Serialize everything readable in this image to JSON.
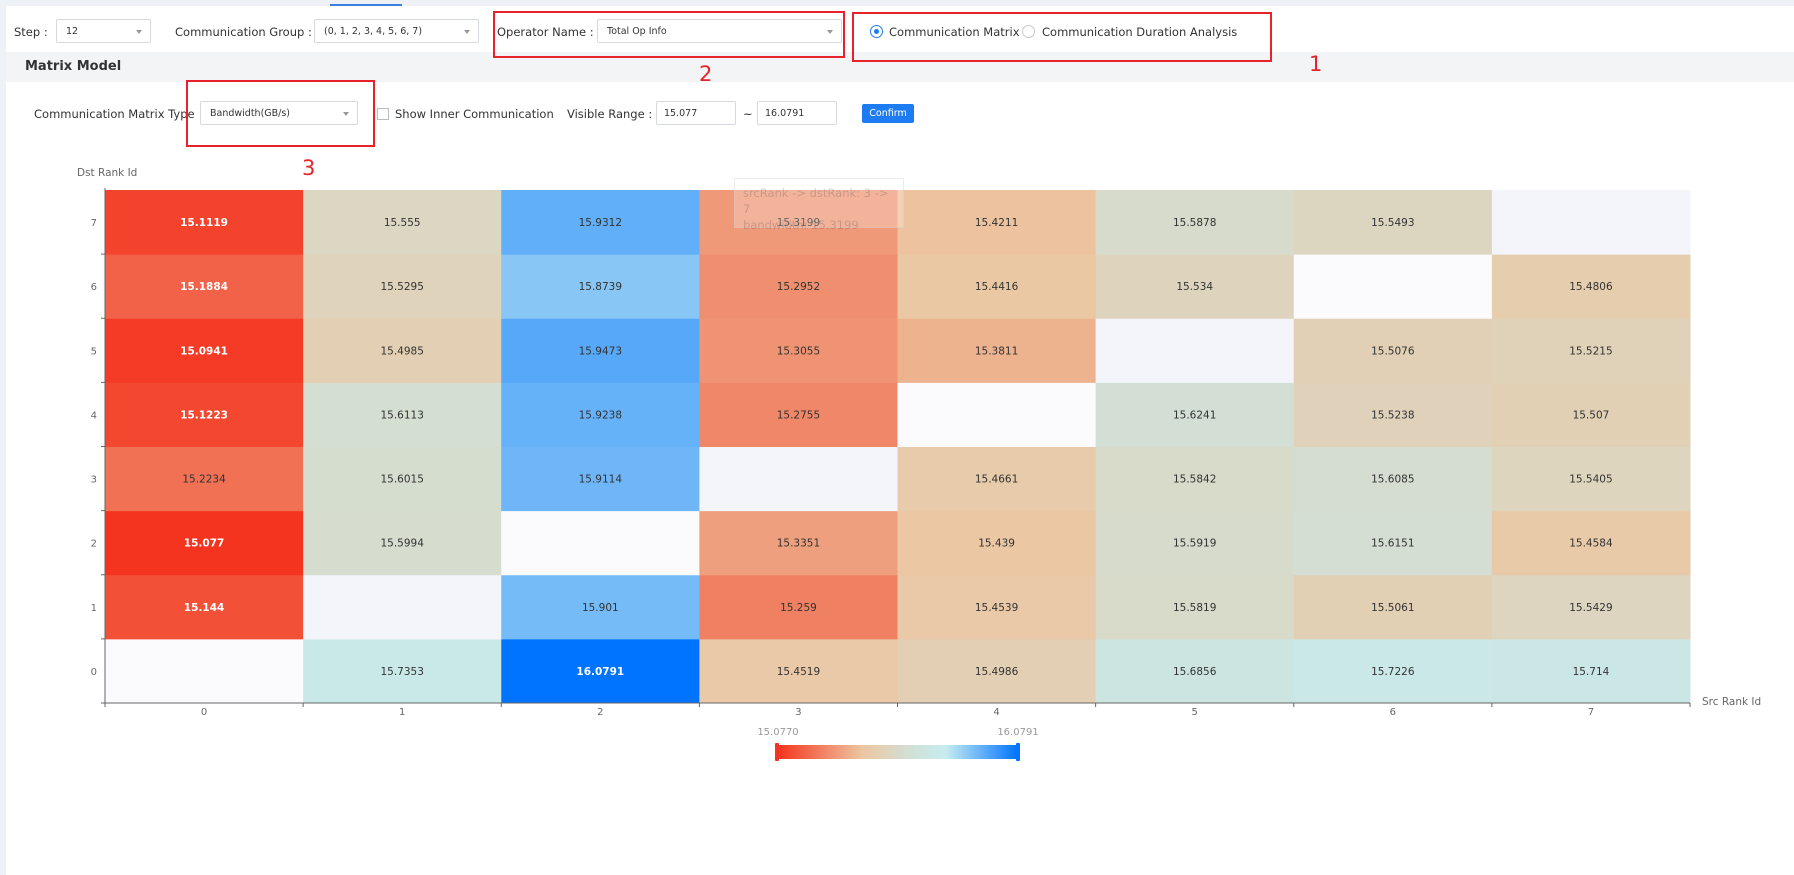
{
  "toolbar": {
    "step_label": "Step :",
    "step_value": "12",
    "group_label": "Communication Group :",
    "group_value": "(0, 1, 2, 3, 4, 5, 6, 7)",
    "operator_label": "Operator Name :",
    "operator_value": "Total Op Info",
    "radio_matrix": "Communication Matrix",
    "radio_duration": "Communication Duration Analysis"
  },
  "section_title": "Matrix Model",
  "controls": {
    "matrix_type_label": "Communication Matrix Type",
    "matrix_type_value": "Bandwidth(GB/s)",
    "inner_label": "Show Inner Communication",
    "range_label": "Visible Range :",
    "range_min": "15.077",
    "range_sep": "~",
    "range_max": "16.0791",
    "confirm_label": "Confirm"
  },
  "annotations": [
    "1",
    "2",
    "3"
  ],
  "tooltip": {
    "line1": "srcRank -> dstRank: 3 -> 7",
    "line2": "bandwidth: 15.3199"
  },
  "visual_map": {
    "min_label": "15.0770",
    "max_label": "16.0791",
    "min": 15.077,
    "max": 16.0791
  },
  "colors": {
    "accent": "#1e7cf2",
    "annotation": "#e8222b",
    "low": "#f5341f",
    "mid": "#c6ecf1",
    "high": "#0073ff"
  },
  "chart_data": {
    "type": "heatmap",
    "ylabel": "Dst Rank Id",
    "xlabel": "Src Rank Id",
    "x_categories": [
      "0",
      "1",
      "2",
      "3",
      "4",
      "5",
      "6",
      "7"
    ],
    "y_categories": [
      "0",
      "1",
      "2",
      "3",
      "4",
      "5",
      "6",
      "7"
    ],
    "values": [
      [
        null,
        15.7353,
        16.0791,
        15.4519,
        15.4986,
        15.6856,
        15.7226,
        15.714
      ],
      [
        15.144,
        null,
        15.901,
        15.259,
        15.4539,
        15.5819,
        15.5061,
        15.5429
      ],
      [
        15.077,
        15.5994,
        null,
        15.3351,
        15.439,
        15.5919,
        15.6151,
        15.4584
      ],
      [
        15.2234,
        15.6015,
        15.9114,
        null,
        15.4661,
        15.5842,
        15.6085,
        15.5405
      ],
      [
        15.1223,
        15.6113,
        15.9238,
        15.2755,
        null,
        15.6241,
        15.5238,
        15.507
      ],
      [
        15.0941,
        15.4985,
        15.9473,
        15.3055,
        15.3811,
        null,
        15.5076,
        15.5215
      ],
      [
        15.1884,
        15.5295,
        15.8739,
        15.2952,
        15.4416,
        15.534,
        null,
        15.4806
      ],
      [
        15.1119,
        15.555,
        15.9312,
        15.3199,
        15.4211,
        15.5878,
        15.5493,
        null
      ]
    ],
    "value_range": [
      15.077,
      16.0791
    ]
  }
}
